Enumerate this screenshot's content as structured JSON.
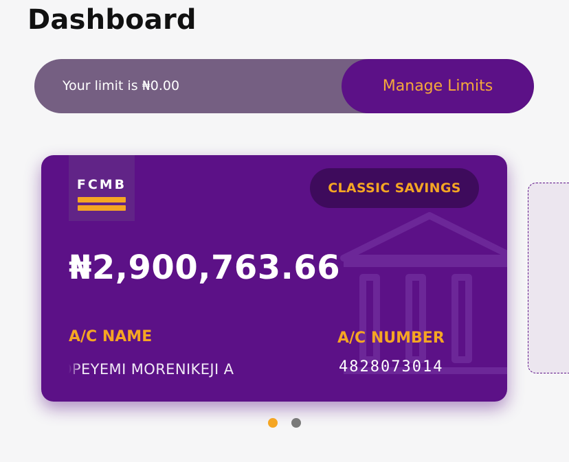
{
  "header": {
    "title": "Dashboard"
  },
  "limit_bar": {
    "text": "Your limit is ₦0.00",
    "manage_label": "Manage Limits"
  },
  "account_card": {
    "bank_logo_text": "FCMB",
    "account_type": "CLASSIC SAVINGS",
    "balance": "₦2,900,763.66",
    "ac_name_label": "A/C NAME",
    "ac_name_value": "OPEYEMI MORENIKEJI   A",
    "ac_number_label": "A/C NUMBER",
    "ac_number_value": "4828073014"
  },
  "pager": {
    "total": 2,
    "active_index": 0
  },
  "colors": {
    "brand_purple": "#5c1187",
    "brand_orange": "#f5a623",
    "limit_bar_bg": "#755f82",
    "page_bg": "#f6f6f7"
  },
  "icons": {
    "watermark": "bank-building-icon"
  }
}
